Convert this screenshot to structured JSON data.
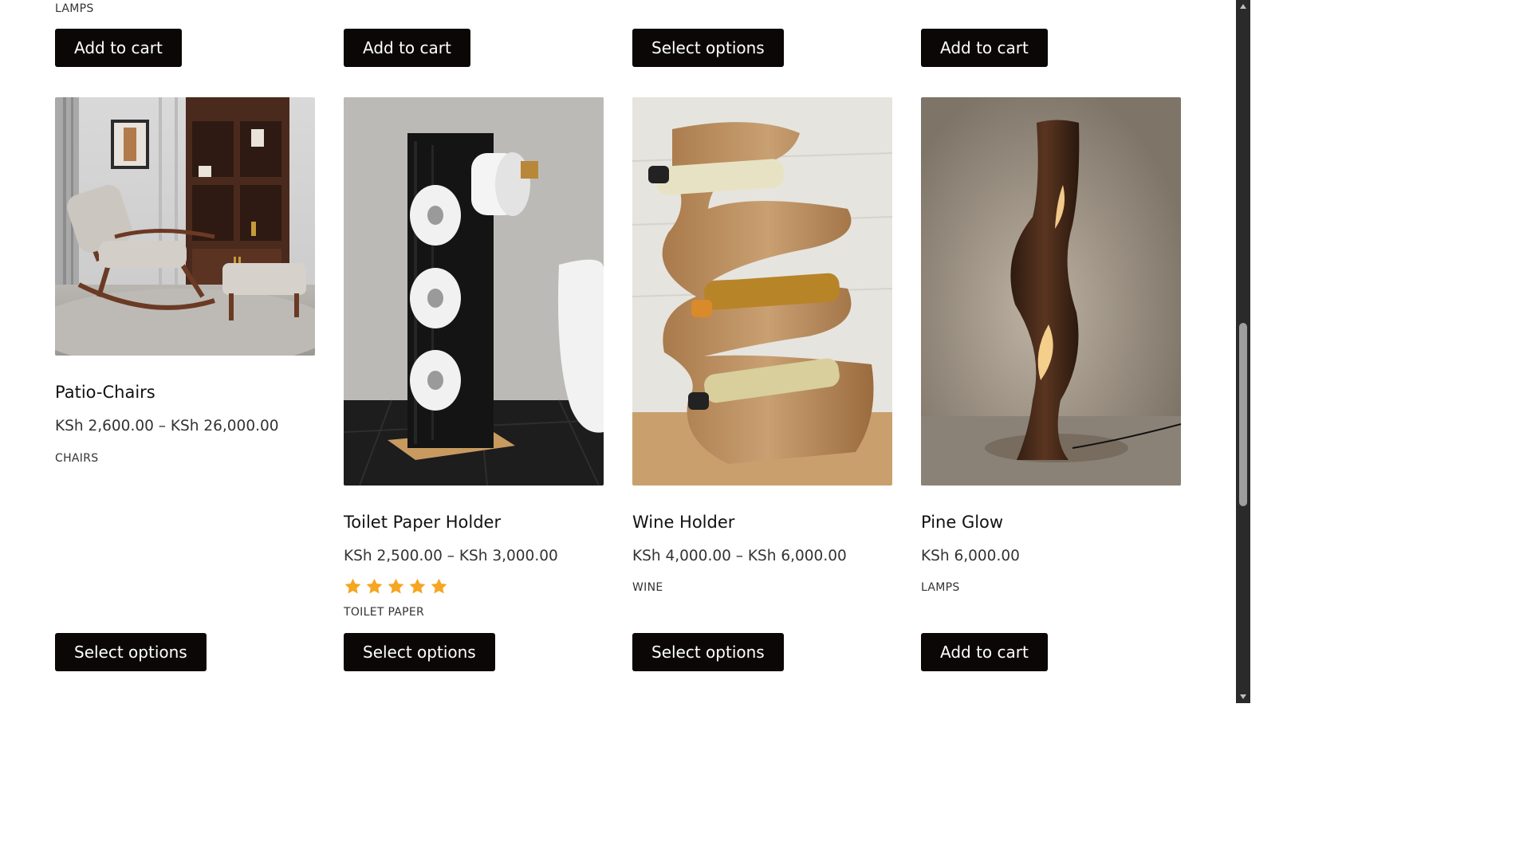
{
  "top_row": {
    "category_first": "LAMPS",
    "buttons": [
      "Add to cart",
      "Add to cart",
      "Select options",
      "Add to cart"
    ]
  },
  "products": [
    {
      "title": "Patio-Chairs",
      "price": "KSh 2,600.00 – KSh 26,000.00",
      "category": "CHAIRS",
      "button": "Select options",
      "rating": null
    },
    {
      "title": "Toilet Paper Holder",
      "price": "KSh 2,500.00 – KSh 3,000.00",
      "category": "TOILET PAPER",
      "button": "Select options",
      "rating": 5
    },
    {
      "title": "Wine Holder",
      "price": "KSh 4,000.00 – KSh 6,000.00",
      "category": "WINE",
      "button": "Select options",
      "rating": null
    },
    {
      "title": "Pine Glow",
      "price": "KSh 6,000.00",
      "category": "LAMPS",
      "button": "Add to cart",
      "rating": null
    }
  ],
  "colors": {
    "button_bg": "#0c0707",
    "star": "#f5a623",
    "scrollbar_bg": "#2a2a2a",
    "scrollbar_thumb": "#9e9e9e"
  },
  "icons": {
    "rating": "star-icon",
    "scroll_up": "chevron-up-icon",
    "scroll_down": "chevron-down-icon"
  }
}
